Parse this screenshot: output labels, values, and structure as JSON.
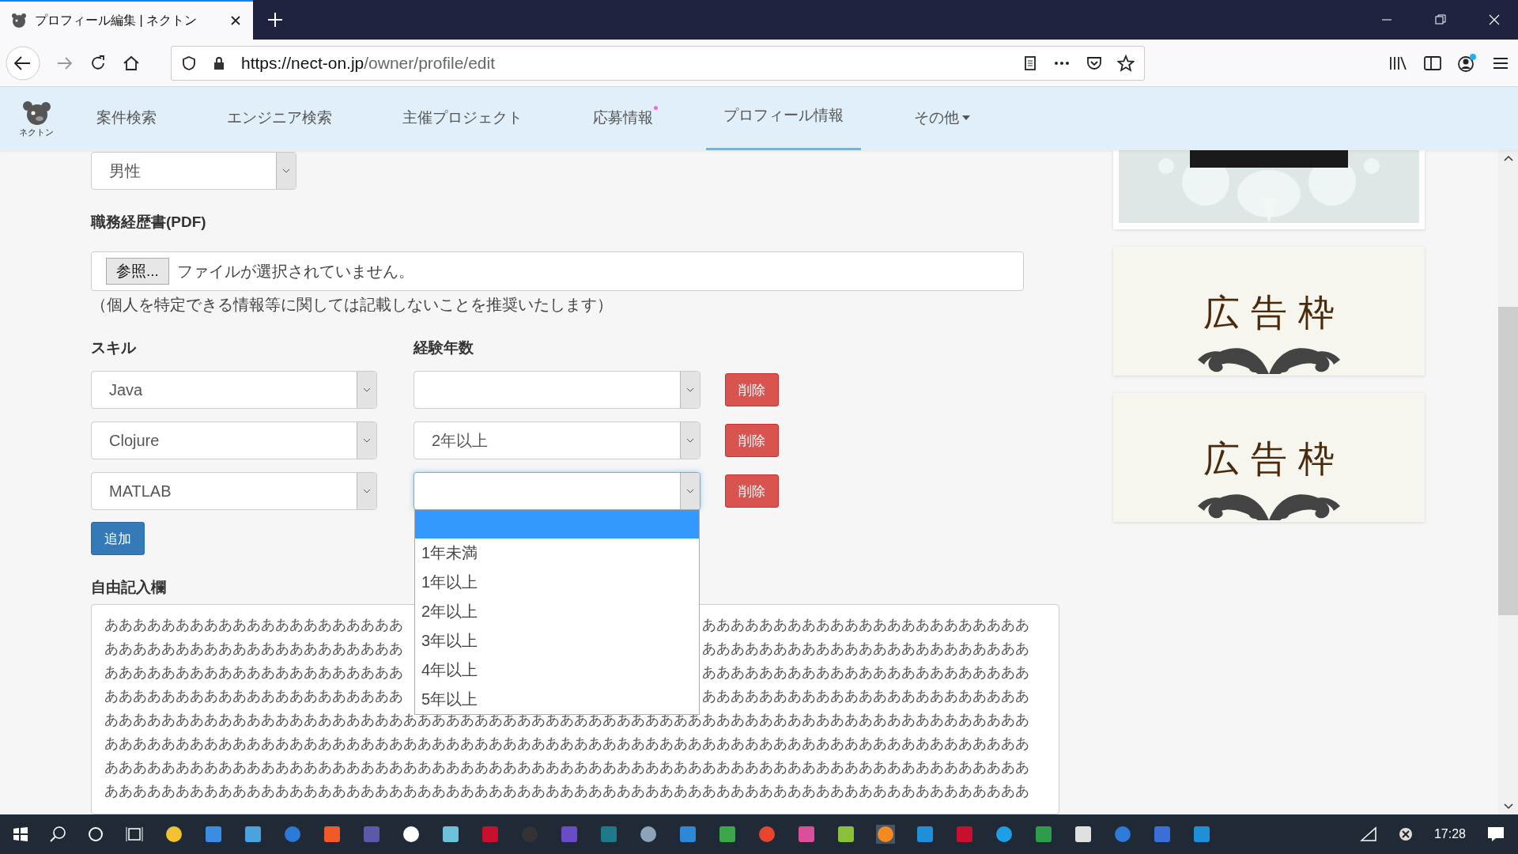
{
  "browser": {
    "tab_title": "プロフィール編集 | ネクトン",
    "url_host": "https://nect-on.jp",
    "url_path": "/owner/profile/edit"
  },
  "site": {
    "logo_text": "ネクトン",
    "nav": [
      {
        "label": "案件検索",
        "selected": false,
        "badge": false,
        "dropdown": false
      },
      {
        "label": "エンジニア検索",
        "selected": false,
        "badge": false,
        "dropdown": false
      },
      {
        "label": "主催プロジェクト",
        "selected": false,
        "badge": false,
        "dropdown": false
      },
      {
        "label": "応募情報",
        "selected": false,
        "badge": true,
        "dropdown": false
      },
      {
        "label": "プロフィール情報",
        "selected": true,
        "badge": false,
        "dropdown": false
      },
      {
        "label": "その他",
        "selected": false,
        "badge": false,
        "dropdown": true
      }
    ]
  },
  "form": {
    "gender": {
      "value": "男性"
    },
    "resume": {
      "label": "職務経歴書(PDF)",
      "browse_button": "参照...",
      "file_status": "ファイルが選択されていません。",
      "note": "（個人を特定できる情報等に関しては記載しないことを推奨いたします）"
    },
    "skills": {
      "skill_header": "スキル",
      "years_header": "経験年数",
      "rows": [
        {
          "skill": "Java",
          "focused": false,
          "delete_button": "削除"
        },
        {
          "skill": "Clojure",
          "years": "2年以上",
          "focused": false,
          "delete_button": "削除"
        },
        {
          "skill": "MATLAB",
          "focused": true,
          "delete_button": "削除",
          "open_options": [
            {
              "selected": true
            },
            {
              "label": "1年未満",
              "selected": false
            },
            {
              "label": "1年以上",
              "selected": false
            },
            {
              "label": "2年以上",
              "selected": false
            },
            {
              "label": "3年以上",
              "selected": false
            },
            {
              "label": "4年以上",
              "selected": false
            },
            {
              "label": "5年以上",
              "selected": false
            }
          ]
        }
      ],
      "add_button": "追加"
    },
    "free_text": {
      "label": "自由記入欄",
      "lines": [
        {
          "left": "あああああああああああああああああああああ",
          "right": "あああああああああああああああああああああああ"
        },
        {
          "left": "あああああああああああああああああああああ",
          "right": "あああああああああああああああああああああああ"
        },
        {
          "left": "あああああああああああああああああああああ",
          "right": "あああああああああああああああああああああああ"
        },
        {
          "left": "あああああああああああああああああああああ",
          "right": "あああああああああああああああああああああああ"
        },
        {
          "text": "あああああああああああああああああああああああああああああああああああああああああああああああああああああああああああああああああ"
        },
        {
          "text": "あああああああああああああああああああああああああああああああああああああああああああああああああああああああああああああああああ"
        },
        {
          "text": "あああああああああああああああああああああああああああああああああああああああああああああああああああああああああああああああああ"
        },
        {
          "text": "あああああああああああああああああああああああああああああああああああああああああああああああああああああああああああああああああ"
        }
      ]
    }
  },
  "ads": [
    {
      "kind": "picture"
    },
    {
      "kind": "banner",
      "text": "広告枠"
    },
    {
      "kind": "banner",
      "text": "広告枠"
    }
  ],
  "taskbar": {
    "time": "17:28"
  }
}
